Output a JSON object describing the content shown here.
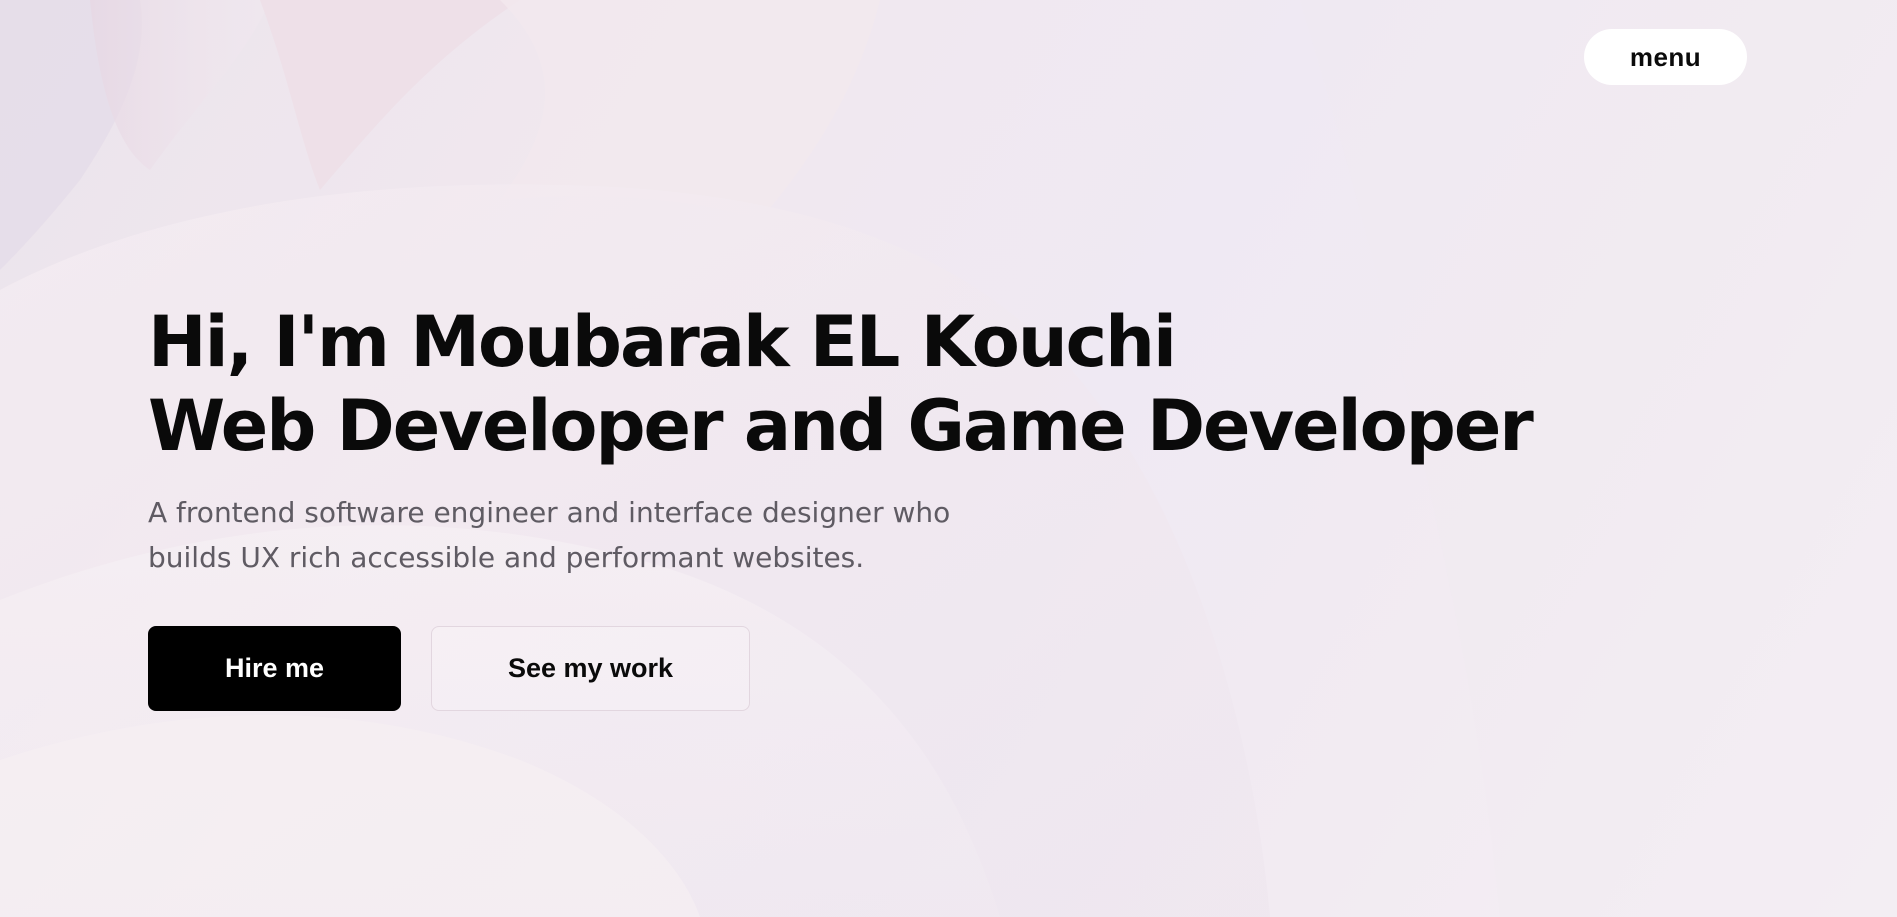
{
  "nav": {
    "menu_label": "menu"
  },
  "hero": {
    "headline_line1": "Hi, I'm Moubarak EL Kouchi",
    "headline_line2": "Web Developer and Game Developer",
    "subtitle_line1": "A frontend software engineer and interface designer who",
    "subtitle_line2": "builds UX rich accessible and performant websites.",
    "primary_cta": "Hire me",
    "secondary_cta": "See my work"
  },
  "colors": {
    "background": "#efe8f0",
    "text": "#0a0a0a",
    "subtitle": "#5f5b63",
    "primary_button": "#000000",
    "menu_button": "#ffffff"
  }
}
